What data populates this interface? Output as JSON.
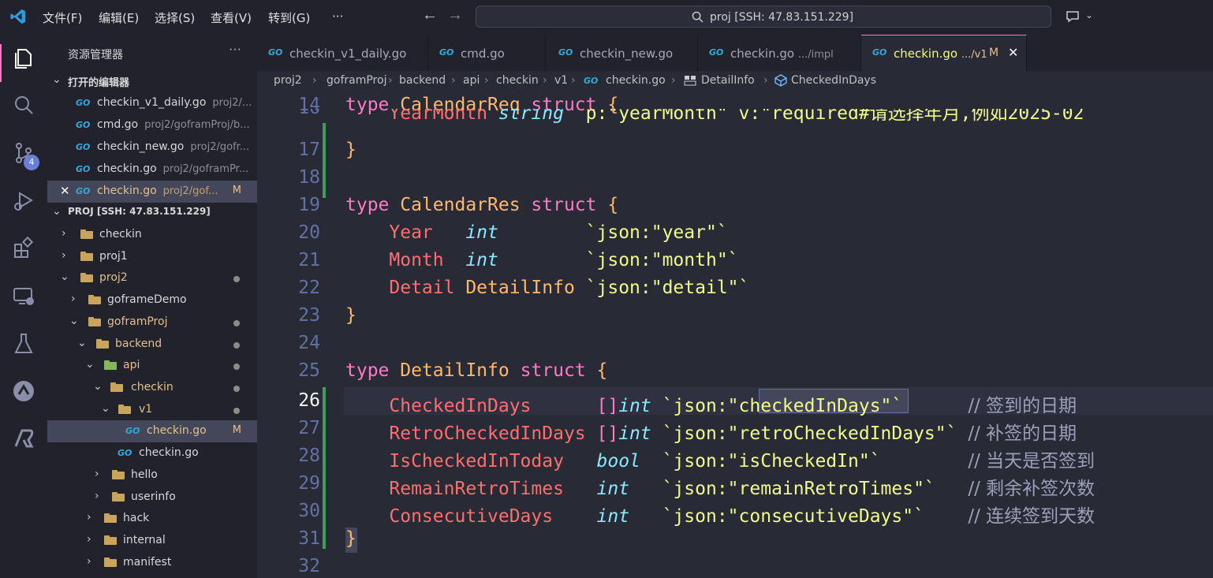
{
  "menu": [
    "文件(F)",
    "编辑(E)",
    "选择(S)",
    "查看(V)",
    "转到(G)",
    "···"
  ],
  "search": {
    "text": "proj [SSH: 47.83.151.229]"
  },
  "activity": {
    "badge": "4"
  },
  "sidebar": {
    "title": "资源管理器",
    "more": "···",
    "open_editors_header": "打开的编辑器",
    "open_editors": [
      {
        "name": "checkin_v1_daily.go",
        "path": "proj2/...",
        "mod": ""
      },
      {
        "name": "cmd.go",
        "path": "proj2/goframProj/b...",
        "mod": ""
      },
      {
        "name": "checkin_new.go",
        "path": "proj2/gofr...",
        "mod": ""
      },
      {
        "name": "checkin.go",
        "path": "proj2/goframPr...",
        "mod": ""
      },
      {
        "name": "checkin.go",
        "path": "proj2/gof...",
        "mod": "M"
      }
    ],
    "project_header": "PROJ [SSH: 47.83.151.229]",
    "tree": [
      {
        "label": "checkin",
        "kind": "folder",
        "chev": "›"
      },
      {
        "label": "proj1",
        "kind": "folder",
        "chev": "›"
      },
      {
        "label": "proj2",
        "kind": "folder",
        "chev": "⌄"
      },
      {
        "label": "goframeDemo",
        "kind": "folder",
        "chev": "›"
      },
      {
        "label": "goframProj",
        "kind": "folder",
        "chev": "⌄"
      },
      {
        "label": "backend",
        "kind": "folder",
        "chev": "⌄"
      },
      {
        "label": "api",
        "kind": "folder",
        "chev": "⌄"
      },
      {
        "label": "checkin",
        "kind": "folder",
        "chev": "⌄"
      },
      {
        "label": "v1",
        "kind": "folder",
        "chev": "⌄"
      },
      {
        "label": "checkin.go",
        "kind": "go",
        "mod": "M"
      },
      {
        "label": "checkin.go",
        "kind": "go"
      },
      {
        "label": "hello",
        "kind": "folder",
        "chev": "›"
      },
      {
        "label": "userinfo",
        "kind": "folder",
        "chev": "›"
      },
      {
        "label": "hack",
        "kind": "folder",
        "chev": "›"
      },
      {
        "label": "internal",
        "kind": "folder",
        "chev": "›"
      },
      {
        "label": "manifest",
        "kind": "folder",
        "chev": "›"
      }
    ]
  },
  "tabs": [
    {
      "name": "checkin_v1_daily.go",
      "desc": ""
    },
    {
      "name": "cmd.go",
      "desc": ""
    },
    {
      "name": "checkin_new.go",
      "desc": ""
    },
    {
      "name": "checkin.go",
      "desc": ".../impl"
    },
    {
      "name": "checkin.go",
      "desc": ".../v1",
      "mod": "M",
      "close": "✕"
    }
  ],
  "breadcrumb": [
    "proj2",
    "goframProj",
    "backend",
    "api",
    "checkin",
    "v1",
    "checkin.go",
    "DetailInfo",
    "CheckedInDays"
  ],
  "editor": {
    "lines": [
      {
        "n": "14",
        "code": [
          [
            "kw",
            "type "
          ],
          [
            "tn",
            "CalendarReq "
          ],
          [
            "kw",
            "struct "
          ],
          [
            "tn",
            "{"
          ]
        ]
      },
      {
        "n": "16",
        "code": [
          [
            "pl",
            "    "
          ],
          [
            "fld",
            "YearMonth "
          ],
          [
            "ty",
            "string "
          ],
          [
            "tag",
            "`p:\"yearMonth\" v:\"required#请选择年月,例如2025-02"
          ]
        ]
      },
      {
        "n": "17",
        "code": [
          [
            "tn",
            "}"
          ]
        ]
      },
      {
        "n": "18",
        "code": []
      },
      {
        "n": "19",
        "code": [
          [
            "kw",
            "type "
          ],
          [
            "tn",
            "CalendarRes "
          ],
          [
            "kw",
            "struct "
          ],
          [
            "tn",
            "{"
          ]
        ]
      },
      {
        "n": "20",
        "code": [
          [
            "pl",
            "    "
          ],
          [
            "fld",
            "Year   "
          ],
          [
            "ty",
            "int        "
          ],
          [
            "tag",
            "`json:\"year\"`"
          ]
        ]
      },
      {
        "n": "21",
        "code": [
          [
            "pl",
            "    "
          ],
          [
            "fld",
            "Month  "
          ],
          [
            "ty",
            "int        "
          ],
          [
            "tag",
            "`json:\"month\"`"
          ]
        ]
      },
      {
        "n": "22",
        "code": [
          [
            "pl",
            "    "
          ],
          [
            "fld",
            "Detail "
          ],
          [
            "tn",
            "DetailInfo "
          ],
          [
            "tag",
            "`json:\"detail\"`"
          ]
        ]
      },
      {
        "n": "23",
        "code": [
          [
            "tn",
            "}"
          ]
        ]
      },
      {
        "n": "24",
        "code": []
      },
      {
        "n": "25",
        "code": [
          [
            "kw",
            "type "
          ],
          [
            "tn",
            "DetailInfo "
          ],
          [
            "kw",
            "struct "
          ],
          [
            "tn",
            "{"
          ]
        ]
      },
      {
        "n": "26",
        "code": [
          [
            "pl",
            "    "
          ],
          [
            "fld",
            "CheckedInDays      "
          ],
          [
            "kw",
            "[]"
          ],
          [
            "ty",
            "int "
          ],
          [
            "tag",
            "`json:\"checkedInDays\"`"
          ],
          [
            "pl",
            "      "
          ],
          [
            "cm",
            "// 签到的日期"
          ]
        ]
      },
      {
        "n": "27",
        "code": [
          [
            "pl",
            "    "
          ],
          [
            "fld",
            "RetroCheckedInDays "
          ],
          [
            "kw",
            "[]"
          ],
          [
            "ty",
            "int "
          ],
          [
            "tag",
            "`json:\"retroCheckedInDays\"`"
          ],
          [
            "pl",
            " "
          ],
          [
            "cm",
            "// 补签的日期"
          ]
        ]
      },
      {
        "n": "28",
        "code": [
          [
            "pl",
            "    "
          ],
          [
            "fld",
            "IsCheckedInToday   "
          ],
          [
            "ty",
            "bool  "
          ],
          [
            "tag",
            "`json:\"isCheckedIn\"`"
          ],
          [
            "pl",
            "        "
          ],
          [
            "cm",
            "// 当天是否签到"
          ]
        ]
      },
      {
        "n": "29",
        "code": [
          [
            "pl",
            "    "
          ],
          [
            "fld",
            "RemainRetroTimes   "
          ],
          [
            "ty",
            "int   "
          ],
          [
            "tag",
            "`json:\"remainRetroTimes\"`"
          ],
          [
            "pl",
            "   "
          ],
          [
            "cm",
            "// 剩余补签次数"
          ]
        ]
      },
      {
        "n": "30",
        "code": [
          [
            "pl",
            "    "
          ],
          [
            "fld",
            "ConsecutiveDays    "
          ],
          [
            "ty",
            "int   "
          ],
          [
            "tag",
            "`json:\"consecutiveDays\"`"
          ],
          [
            "pl",
            "    "
          ],
          [
            "cm",
            "// 连续签到天数"
          ]
        ]
      },
      {
        "n": "31",
        "code": [
          [
            "tn",
            "}"
          ]
        ]
      },
      {
        "n": "32",
        "code": []
      }
    ],
    "current_line": "26"
  }
}
